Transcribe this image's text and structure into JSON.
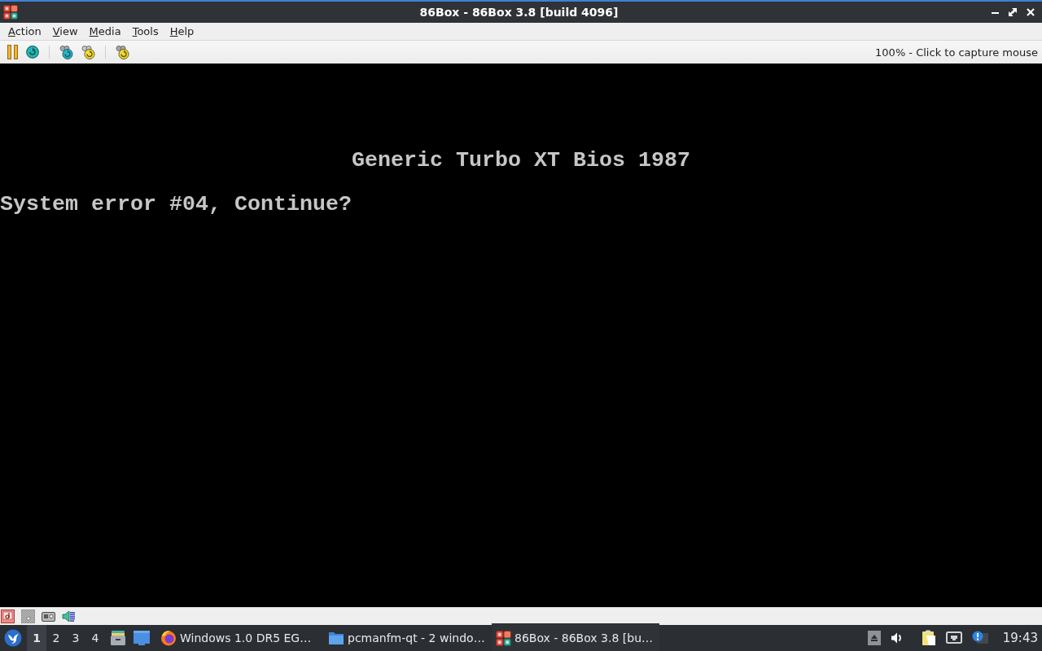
{
  "window": {
    "title": "86Box - 86Box 3.8 [build 4096]"
  },
  "menu_bar": {
    "items": [
      "Action",
      "View",
      "Media",
      "Tools",
      "Help"
    ]
  },
  "toolbar": {
    "status": "100% - Click to capture mouse"
  },
  "screen": {
    "header": "Generic Turbo XT Bios 1987",
    "prompt": "System error #04, Continue?"
  },
  "taskbar": {
    "workspaces": [
      {
        "label": "1",
        "selected": true
      },
      {
        "label": "2",
        "selected": false
      },
      {
        "label": "3",
        "selected": false
      },
      {
        "label": "4",
        "selected": false
      }
    ],
    "tasks": [
      {
        "kind": "browser",
        "label": "Windows 1.0 DR5 EG…",
        "selected": false
      },
      {
        "kind": "folder",
        "label": "pcmanfm-qt - 2 windo…",
        "selected": false
      },
      {
        "kind": "emulator",
        "label": "86Box - 86Box 3.8 [bu…",
        "selected": true
      }
    ],
    "clock": "19:43"
  }
}
